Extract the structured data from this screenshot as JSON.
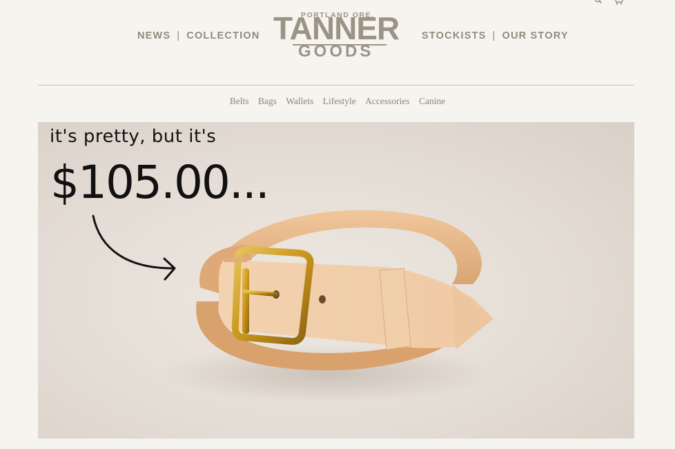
{
  "header": {
    "nav_left": [
      "NEWS",
      "COLLECTION"
    ],
    "nav_right": [
      "STOCKISTS",
      "OUR STORY"
    ],
    "separator": "|",
    "logo": {
      "top": "PORTLAND ORE.",
      "main": "TANNER",
      "sub": "GOODS"
    },
    "icons": [
      "search-icon",
      "cart-icon"
    ]
  },
  "subnav": [
    "Belts",
    "Bags",
    "Wallets",
    "Lifestyle",
    "Accessories",
    "Canine"
  ],
  "hero": {
    "line1": "it's pretty, but it's",
    "line2": "$105.00...",
    "colors": {
      "leather": "#e8b889",
      "buckle": "#c99a1e",
      "ink": "#111111"
    }
  },
  "colors": {
    "background": "#f5f4ef",
    "nav_text": "#8f8b7d",
    "rule": "#c7c1a7"
  }
}
